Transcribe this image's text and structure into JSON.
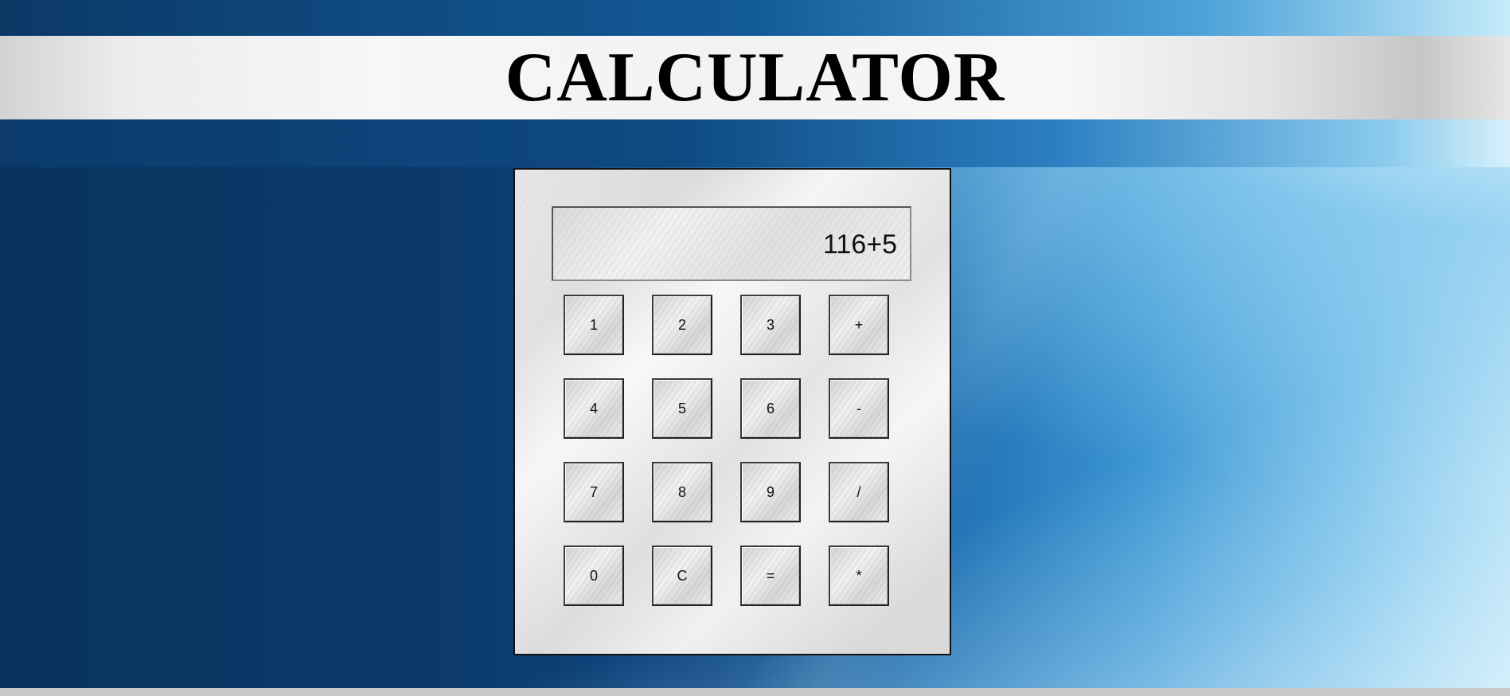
{
  "header": {
    "title": "CALCULATOR"
  },
  "calculator": {
    "display_value": "116+5",
    "keys": [
      {
        "label": "1",
        "name": "key-1"
      },
      {
        "label": "2",
        "name": "key-2"
      },
      {
        "label": "3",
        "name": "key-3"
      },
      {
        "label": "+",
        "name": "key-add"
      },
      {
        "label": "4",
        "name": "key-4"
      },
      {
        "label": "5",
        "name": "key-5"
      },
      {
        "label": "6",
        "name": "key-6"
      },
      {
        "label": "-",
        "name": "key-subtract"
      },
      {
        "label": "7",
        "name": "key-7"
      },
      {
        "label": "8",
        "name": "key-8"
      },
      {
        "label": "9",
        "name": "key-9"
      },
      {
        "label": "/",
        "name": "key-divide"
      },
      {
        "label": "0",
        "name": "key-0"
      },
      {
        "label": "C",
        "name": "key-clear"
      },
      {
        "label": "=",
        "name": "key-equals"
      },
      {
        "label": "*",
        "name": "key-multiply"
      }
    ]
  }
}
